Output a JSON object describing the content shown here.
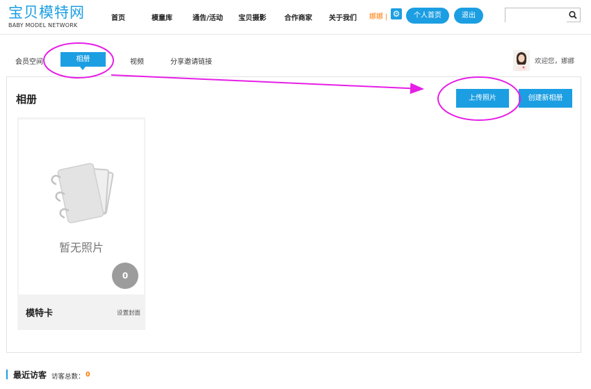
{
  "logo": {
    "cn": "宝贝模特网",
    "en": "BABY MODEL NETWORK"
  },
  "nav": [
    "首页",
    "模童库",
    "通告/活动",
    "宝贝摄影",
    "合作商家",
    "关于我们"
  ],
  "user": {
    "name": "娜娜",
    "sep": "|"
  },
  "header_buttons": {
    "home": "个人首页",
    "logout": "退出"
  },
  "search": {
    "placeholder": ""
  },
  "subnav": {
    "tabs": [
      "会员空间",
      "相册",
      "视频",
      "分享邀请链接"
    ],
    "welcome": "欢迎您，娜娜"
  },
  "album": {
    "title": "相册",
    "upload_label": "上传照片",
    "create_label": "创建新相册",
    "card": {
      "empty_text": "暂无照片",
      "count": "0",
      "name": "模特卡",
      "cover_label": "设置封面"
    }
  },
  "visitors": {
    "title": "最近访客",
    "count_label": "访客总数：",
    "count": "0"
  },
  "colors": {
    "accent": "#1c9ee2",
    "highlight": "#e61ee6",
    "orange": "#ff7a00"
  },
  "icons": {
    "settings": "gear-icon",
    "search": "search-icon",
    "album": "album-icon"
  }
}
